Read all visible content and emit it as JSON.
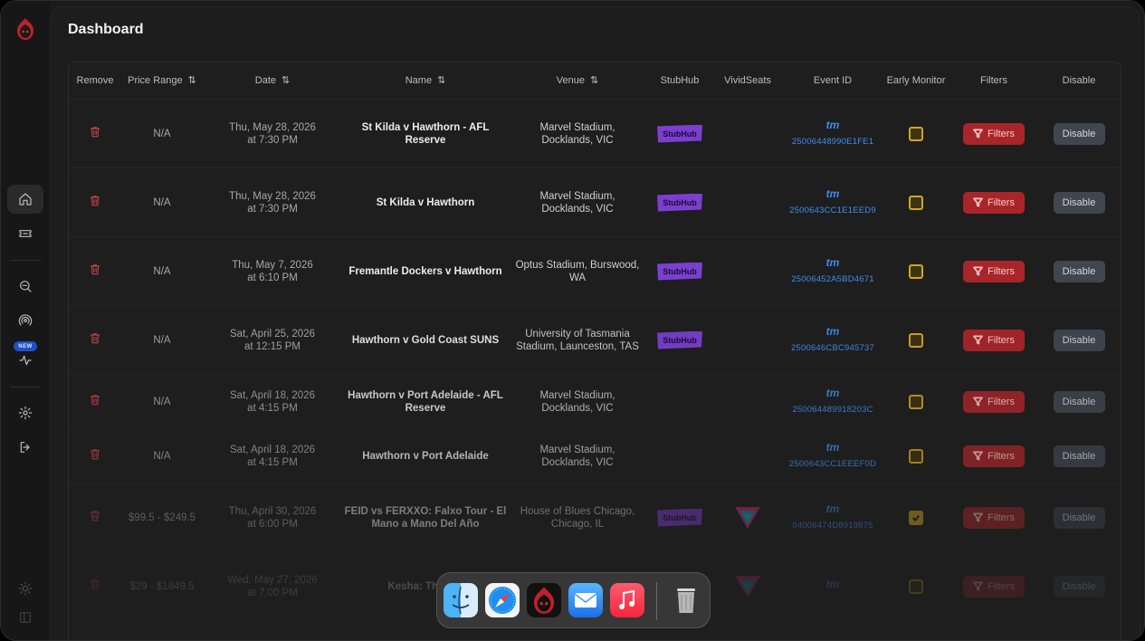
{
  "page": {
    "title": "Dashboard"
  },
  "sidebar": {
    "new_badge": "NEW",
    "items": [
      {
        "icon": "home-icon",
        "active": true
      },
      {
        "icon": "ticket-icon"
      },
      {
        "icon": "search-icon"
      },
      {
        "icon": "broadcast-icon"
      },
      {
        "icon": "activity-icon"
      },
      {
        "icon": "gear-icon"
      },
      {
        "icon": "logout-icon"
      },
      {
        "icon": "sun-icon"
      },
      {
        "icon": "panel-icon"
      }
    ]
  },
  "table": {
    "headers": {
      "remove": "Remove",
      "price_range": "Price Range",
      "date": "Date",
      "name": "Name",
      "venue": "Venue",
      "stubhub": "StubHub",
      "vividseats": "VividSeats",
      "event_id": "Event ID",
      "early_monitor": "Early Monitor",
      "filters": "Filters",
      "disable": "Disable"
    },
    "sort_glyph": "⇅",
    "stubhub_label": "StubHub",
    "tm_label": "tm",
    "filters_label": "Filters",
    "disable_label": "Disable",
    "rows": [
      {
        "price": "N/A",
        "date1": "Thu, May 28, 2026",
        "date2": "at 7:30 PM",
        "name": "St Kilda v Hawthorn - AFL Reserve",
        "venue": "Marvel Stadium, Docklands, VIC",
        "stubhub": true,
        "vivid": false,
        "event_id": "25006448990E1FE1",
        "early": false
      },
      {
        "price": "N/A",
        "date1": "Thu, May 28, 2026",
        "date2": "at 7:30 PM",
        "name": "St Kilda v Hawthorn",
        "venue": "Marvel Stadium, Docklands, VIC",
        "stubhub": true,
        "vivid": false,
        "event_id": "2500643CC1E1EED9",
        "early": false
      },
      {
        "price": "N/A",
        "date1": "Thu, May 7, 2026",
        "date2": "at 6:10 PM",
        "name": "Fremantle Dockers v Hawthorn",
        "venue": "Optus Stadium, Burswood, WA",
        "stubhub": true,
        "vivid": false,
        "event_id": "25006452A5BD4671",
        "early": false
      },
      {
        "price": "N/A",
        "date1": "Sat, April 25, 2026",
        "date2": "at 12:15 PM",
        "name": "Hawthorn v Gold Coast SUNS",
        "venue": "University of Tasmania Stadium, Launceston, TAS",
        "stubhub": true,
        "vivid": false,
        "event_id": "2500646CBC945737",
        "early": false
      },
      {
        "price": "N/A",
        "date1": "Sat, April 18, 2026",
        "date2": "at 4:15 PM",
        "name": "Hawthorn v Port Adelaide - AFL Reserve",
        "venue": "Marvel Stadium, Docklands, VIC",
        "stubhub": false,
        "vivid": false,
        "event_id": "250064489918203C",
        "early": false
      },
      {
        "price": "N/A",
        "date1": "Sat, April 18, 2026",
        "date2": "at 4:15 PM",
        "name": "Hawthorn v Port Adelaide",
        "venue": "Marvel Stadium, Docklands, VIC",
        "stubhub": false,
        "vivid": false,
        "event_id": "2500643CC1EEEF0D",
        "early": false
      },
      {
        "price": "$99.5 - $249.5",
        "date1": "Thu, April 30, 2026",
        "date2": "at 6:00 PM",
        "name": "FEID vs FERXXO: Falxo Tour - El Mano a Mano Del Año",
        "venue": "House of Blues Chicago, Chicago, IL",
        "stubhub": true,
        "vivid": true,
        "event_id": "04006474D8919875",
        "early": true
      },
      {
        "price": "$29 - $1849.5",
        "date1": "Wed, May 27, 2026",
        "date2": "at 7:00 PM",
        "name": "Kesha: The Fre",
        "venue": "",
        "stubhub": false,
        "vivid": true,
        "event_id": "",
        "early": false
      }
    ]
  },
  "dock": {
    "apps": [
      {
        "icon": "finder-icon"
      },
      {
        "icon": "safari-icon"
      },
      {
        "icon": "app-logo-icon"
      },
      {
        "icon": "mail-icon"
      },
      {
        "icon": "music-icon"
      },
      {
        "icon": "trash-icon"
      }
    ]
  },
  "colors": {
    "accent_red": "#a8252a",
    "stubhub_purple": "#7b3fd0",
    "tm_blue": "#3f8ef0",
    "checkbox_yellow": "#d3a520"
  }
}
